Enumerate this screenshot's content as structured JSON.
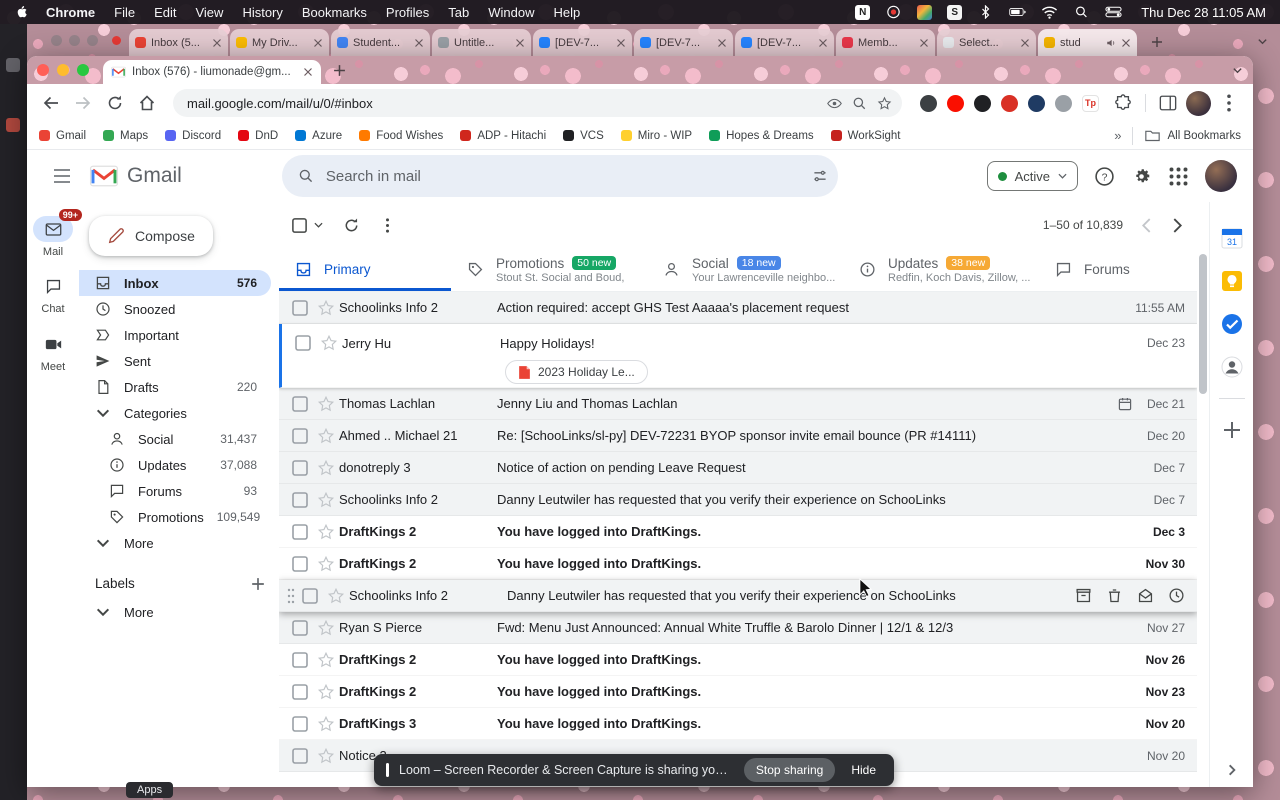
{
  "theme": {
    "accent_blue": "#0b57d0",
    "selected_row_border": "#1a73e8",
    "unread_bg": "#ffffff",
    "read_bg": "#f1f3f4",
    "active_dot_green": "#1e8e3e",
    "unread_rail_badge": "#b3261e",
    "compose_shadow": "#ffffff"
  },
  "menubar": {
    "items": [
      "Chrome",
      "File",
      "Edit",
      "View",
      "History",
      "Bookmarks",
      "Profiles",
      "Tab",
      "Window",
      "Help"
    ],
    "status_icons": [
      "notion",
      "screen-record",
      "keyboard",
      "shortcuts",
      "bluetooth",
      "battery",
      "wifi",
      "spotlight",
      "control-center"
    ],
    "clock": "Thu Dec 28 11:05 AM"
  },
  "background_window": {
    "tabs": [
      {
        "label": "Inbox (5...",
        "color": "#ea4335"
      },
      {
        "label": "My Driv...",
        "color": "#fbbc04"
      },
      {
        "label": "Student...",
        "color": "#4285f4"
      },
      {
        "label": "Untitle...",
        "color": "#9aa0a6"
      },
      {
        "label": "[DEV-7...",
        "color": "#2684ff"
      },
      {
        "label": "[DEV-7...",
        "color": "#2684ff"
      },
      {
        "label": "[DEV-7...",
        "color": "#2684ff"
      },
      {
        "label": "Memb...",
        "color": "#e8374a"
      },
      {
        "label": "Select...",
        "color": "#e8eaed"
      },
      {
        "label": "stud",
        "color": "#f4b400",
        "audio": true
      }
    ]
  },
  "chrome": {
    "tab_title": "Inbox (576) - liumonade@gm...",
    "url": "mail.google.com/mail/u/0/#inbox",
    "extensions": [
      {
        "name": "reader",
        "color": "#3c4043"
      },
      {
        "name": "adobe-acrobat",
        "color": "#fa0f00"
      },
      {
        "name": "notes",
        "color": "#202124"
      },
      {
        "name": "recorder",
        "color": "#d93025"
      },
      {
        "name": "workspace",
        "color": "#1f3b63"
      },
      {
        "name": "utility",
        "color": "#9aa0a6"
      },
      {
        "name": "teleparty",
        "color": "#ffffff",
        "text": "Tp"
      }
    ],
    "bookmarks": [
      {
        "label": "Gmail",
        "color": "#ea4335"
      },
      {
        "label": "Maps",
        "color": "#34a853"
      },
      {
        "label": "Discord",
        "color": "#5865f2"
      },
      {
        "label": "DnD",
        "color": "#e40712"
      },
      {
        "label": "Azure",
        "color": "#0078d4"
      },
      {
        "label": "Food Wishes",
        "color": "#ff7a00"
      },
      {
        "label": "ADP - Hitachi",
        "color": "#d0271d"
      },
      {
        "label": "VCS",
        "color": "#202124"
      },
      {
        "label": "Miro - WIP",
        "color": "#ffd02f"
      },
      {
        "label": "Hopes & Dreams",
        "color": "#0f9d58"
      },
      {
        "label": "WorkSight",
        "color": "#c5221f"
      }
    ],
    "all_bookmarks": "All Bookmarks"
  },
  "gmail": {
    "logo_text": "Gmail",
    "search_placeholder": "Search in mail",
    "status_chip": "Active",
    "rail": [
      {
        "label": "Mail",
        "badge": "99+",
        "selected": true
      },
      {
        "label": "Chat"
      },
      {
        "label": "Meet"
      }
    ],
    "compose_label": "Compose",
    "nav": [
      {
        "label": "Inbox",
        "count": "576",
        "icon": "inbox",
        "selected": true
      },
      {
        "label": "Snoozed",
        "icon": "clock"
      },
      {
        "label": "Important",
        "icon": "important"
      },
      {
        "label": "Sent",
        "icon": "send"
      },
      {
        "label": "Drafts",
        "count": "220",
        "icon": "draft"
      },
      {
        "label": "Categories",
        "icon": "chevron-down"
      },
      {
        "label": "Social",
        "count": "31,437",
        "icon": "person",
        "indent": true
      },
      {
        "label": "Updates",
        "count": "37,088",
        "icon": "info",
        "indent": true
      },
      {
        "label": "Forums",
        "count": "93",
        "icon": "chat",
        "indent": true
      },
      {
        "label": "Promotions",
        "count": "109,549",
        "icon": "tag",
        "indent": true
      },
      {
        "label": "More",
        "icon": "chevron-down"
      }
    ],
    "labels_header": "Labels",
    "labels_more": "More",
    "pagination": "1–50 of 10,839",
    "tabs": [
      {
        "label": "Primary",
        "icon": "inbox-tab",
        "selected": true
      },
      {
        "label": "Promotions",
        "icon": "tag",
        "badge": "50 new",
        "badge_color": "#16a765",
        "sub": "Stout St. Social and Boud,"
      },
      {
        "label": "Social",
        "icon": "person",
        "badge": "18 new",
        "badge_color": "#4986e7",
        "sub": "Your Lawrenceville neighbo..."
      },
      {
        "label": "Updates",
        "icon": "info",
        "badge": "38 new",
        "badge_color": "#f6a935",
        "sub": "Redfin, Koch Davis, Zillow, ..."
      },
      {
        "label": "Forums",
        "icon": "chat"
      }
    ],
    "emails": [
      {
        "sender": "Schoolinks Info 2",
        "subject": "Action required: accept GHS Test Aaaaa's placement request",
        "date": "11:55 AM",
        "unread": false
      },
      {
        "sender": "Jerry Hu",
        "subject": "Happy Holidays!",
        "date": "Dec 23",
        "unread": false,
        "selected": true,
        "attachment": {
          "label": "2023 Holiday Le...",
          "type": "PDF"
        }
      },
      {
        "sender": "Thomas Lachlan",
        "subject": "Jenny Liu and Thomas Lachlan",
        "date": "Dec 21",
        "unread": false,
        "calendar": true
      },
      {
        "sender": "Ahmed .. Michael 21",
        "subject": "Re: [SchooLinks/sl-py] DEV-72231 BYOP sponsor invite email bounce (PR #14111)",
        "date": "Dec 20",
        "unread": false
      },
      {
        "sender": "donotreply 3",
        "subject": "Notice of action on pending Leave Request",
        "date": "Dec 7",
        "unread": false
      },
      {
        "sender": "Schoolinks Info 2",
        "subject": "Danny Leutwiler has requested that you verify their experience on SchooLinks",
        "date": "Dec 7",
        "unread": false
      },
      {
        "sender": "DraftKings 2",
        "subject": "You have logged into DraftKings.",
        "date": "Dec 3",
        "unread": true
      },
      {
        "sender": "DraftKings 2",
        "subject": "You have logged into DraftKings.",
        "date": "Nov 30",
        "unread": true
      },
      {
        "sender": "Schoolinks Info 2",
        "subject": "Danny Leutwiler has requested that you verify their experience on SchooLinks",
        "date": "",
        "unread": false,
        "hover": true
      },
      {
        "sender": "Ryan S Pierce",
        "subject": "Fwd: Menu Just Announced: Annual White Truffle & Barolo Dinner | 12/1 & 12/3",
        "date": "Nov 27",
        "unread": false
      },
      {
        "sender": "DraftKings 2",
        "subject": "You have logged into DraftKings.",
        "date": "Nov 26",
        "unread": true
      },
      {
        "sender": "DraftKings 2",
        "subject": "You have logged into DraftKings.",
        "date": "Nov 23",
        "unread": true
      },
      {
        "sender": "DraftKings 3",
        "subject": "You have logged into DraftKings.",
        "date": "Nov 20",
        "unread": true
      },
      {
        "sender": "Notice 2",
        "subject": "",
        "date": "Nov 20",
        "unread": false
      }
    ],
    "panel_icons": [
      {
        "name": "calendar"
      },
      {
        "name": "keep"
      },
      {
        "name": "tasks"
      },
      {
        "name": "contacts"
      },
      {
        "name": "get-addons"
      }
    ]
  },
  "loom": {
    "text": "Loom – Screen Recorder & Screen Capture is sharing your screen.",
    "stop_label": "Stop sharing",
    "hide_label": "Hide"
  },
  "misc": {
    "apps_label": "Apps"
  }
}
